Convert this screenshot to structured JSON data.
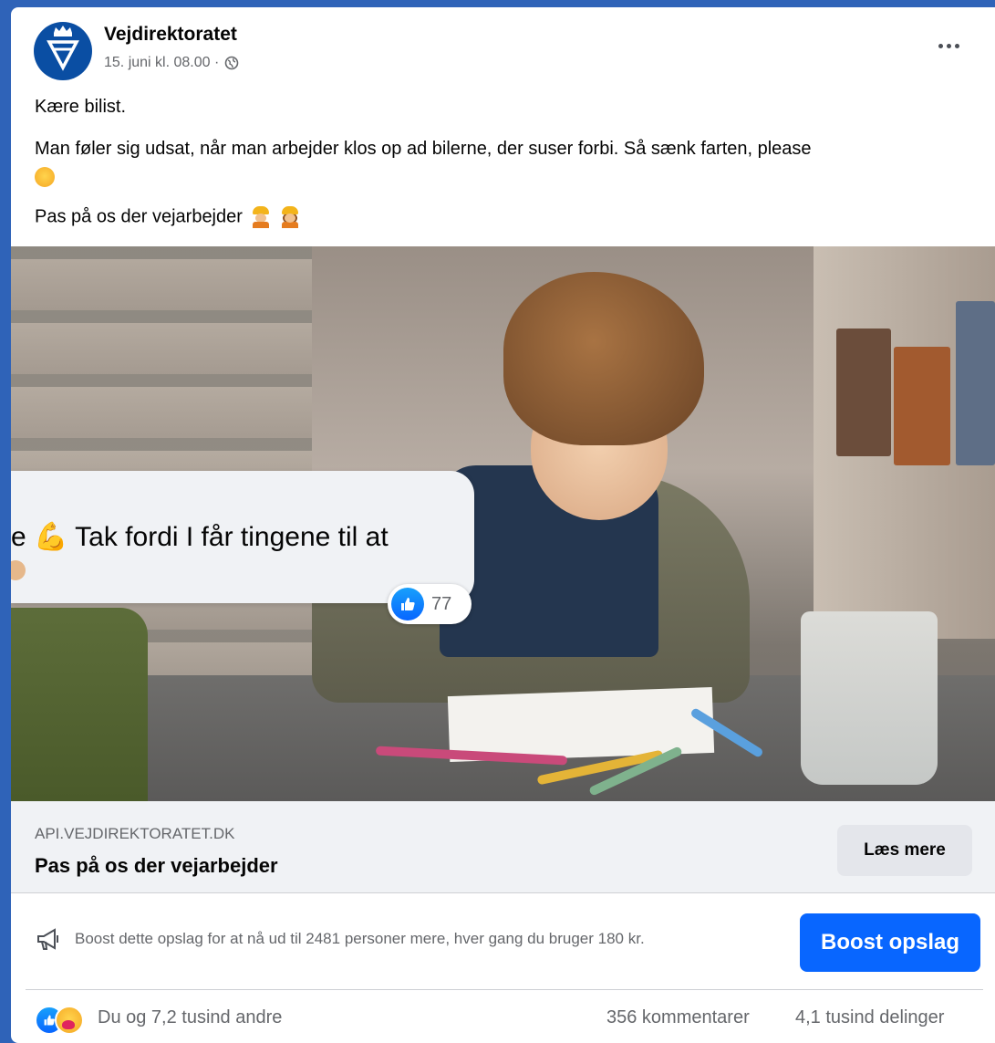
{
  "post": {
    "page_name": "Vejdirektoratet",
    "timestamp": "15. juni kl. 08.00 ·",
    "audience_icon": "globe-icon",
    "more_icon": "more-options-icon",
    "greeting": "Kære bilist.",
    "body_line": "Man føler sig udsat, når man arbejder klos op ad bilerne, der suser forbi. Så sænk farten, please",
    "tagline": "Pas på os der vejarbejder"
  },
  "overlay_comment": {
    "text": "e 💪 Tak fordi I får tingene til at",
    "reaction_count": "77"
  },
  "link_preview": {
    "domain": "API.VEJDIREKTORATET.DK",
    "title": "Pas på os der vejarbejder",
    "cta_label": "Læs mere"
  },
  "boost": {
    "text": "Boost dette opslag for at nå ud til 2481 personer mere, hver gang du bruger 180 kr.",
    "button_label": "Boost opslag"
  },
  "footer": {
    "reactors": "Du og 7,2 tusind andre",
    "comments": "356 kommentarer",
    "shares": "4,1 tusind delinger"
  },
  "colors": {
    "accent": "#0866ff",
    "background": "#2f63b8",
    "secondary_text": "#65676b"
  }
}
